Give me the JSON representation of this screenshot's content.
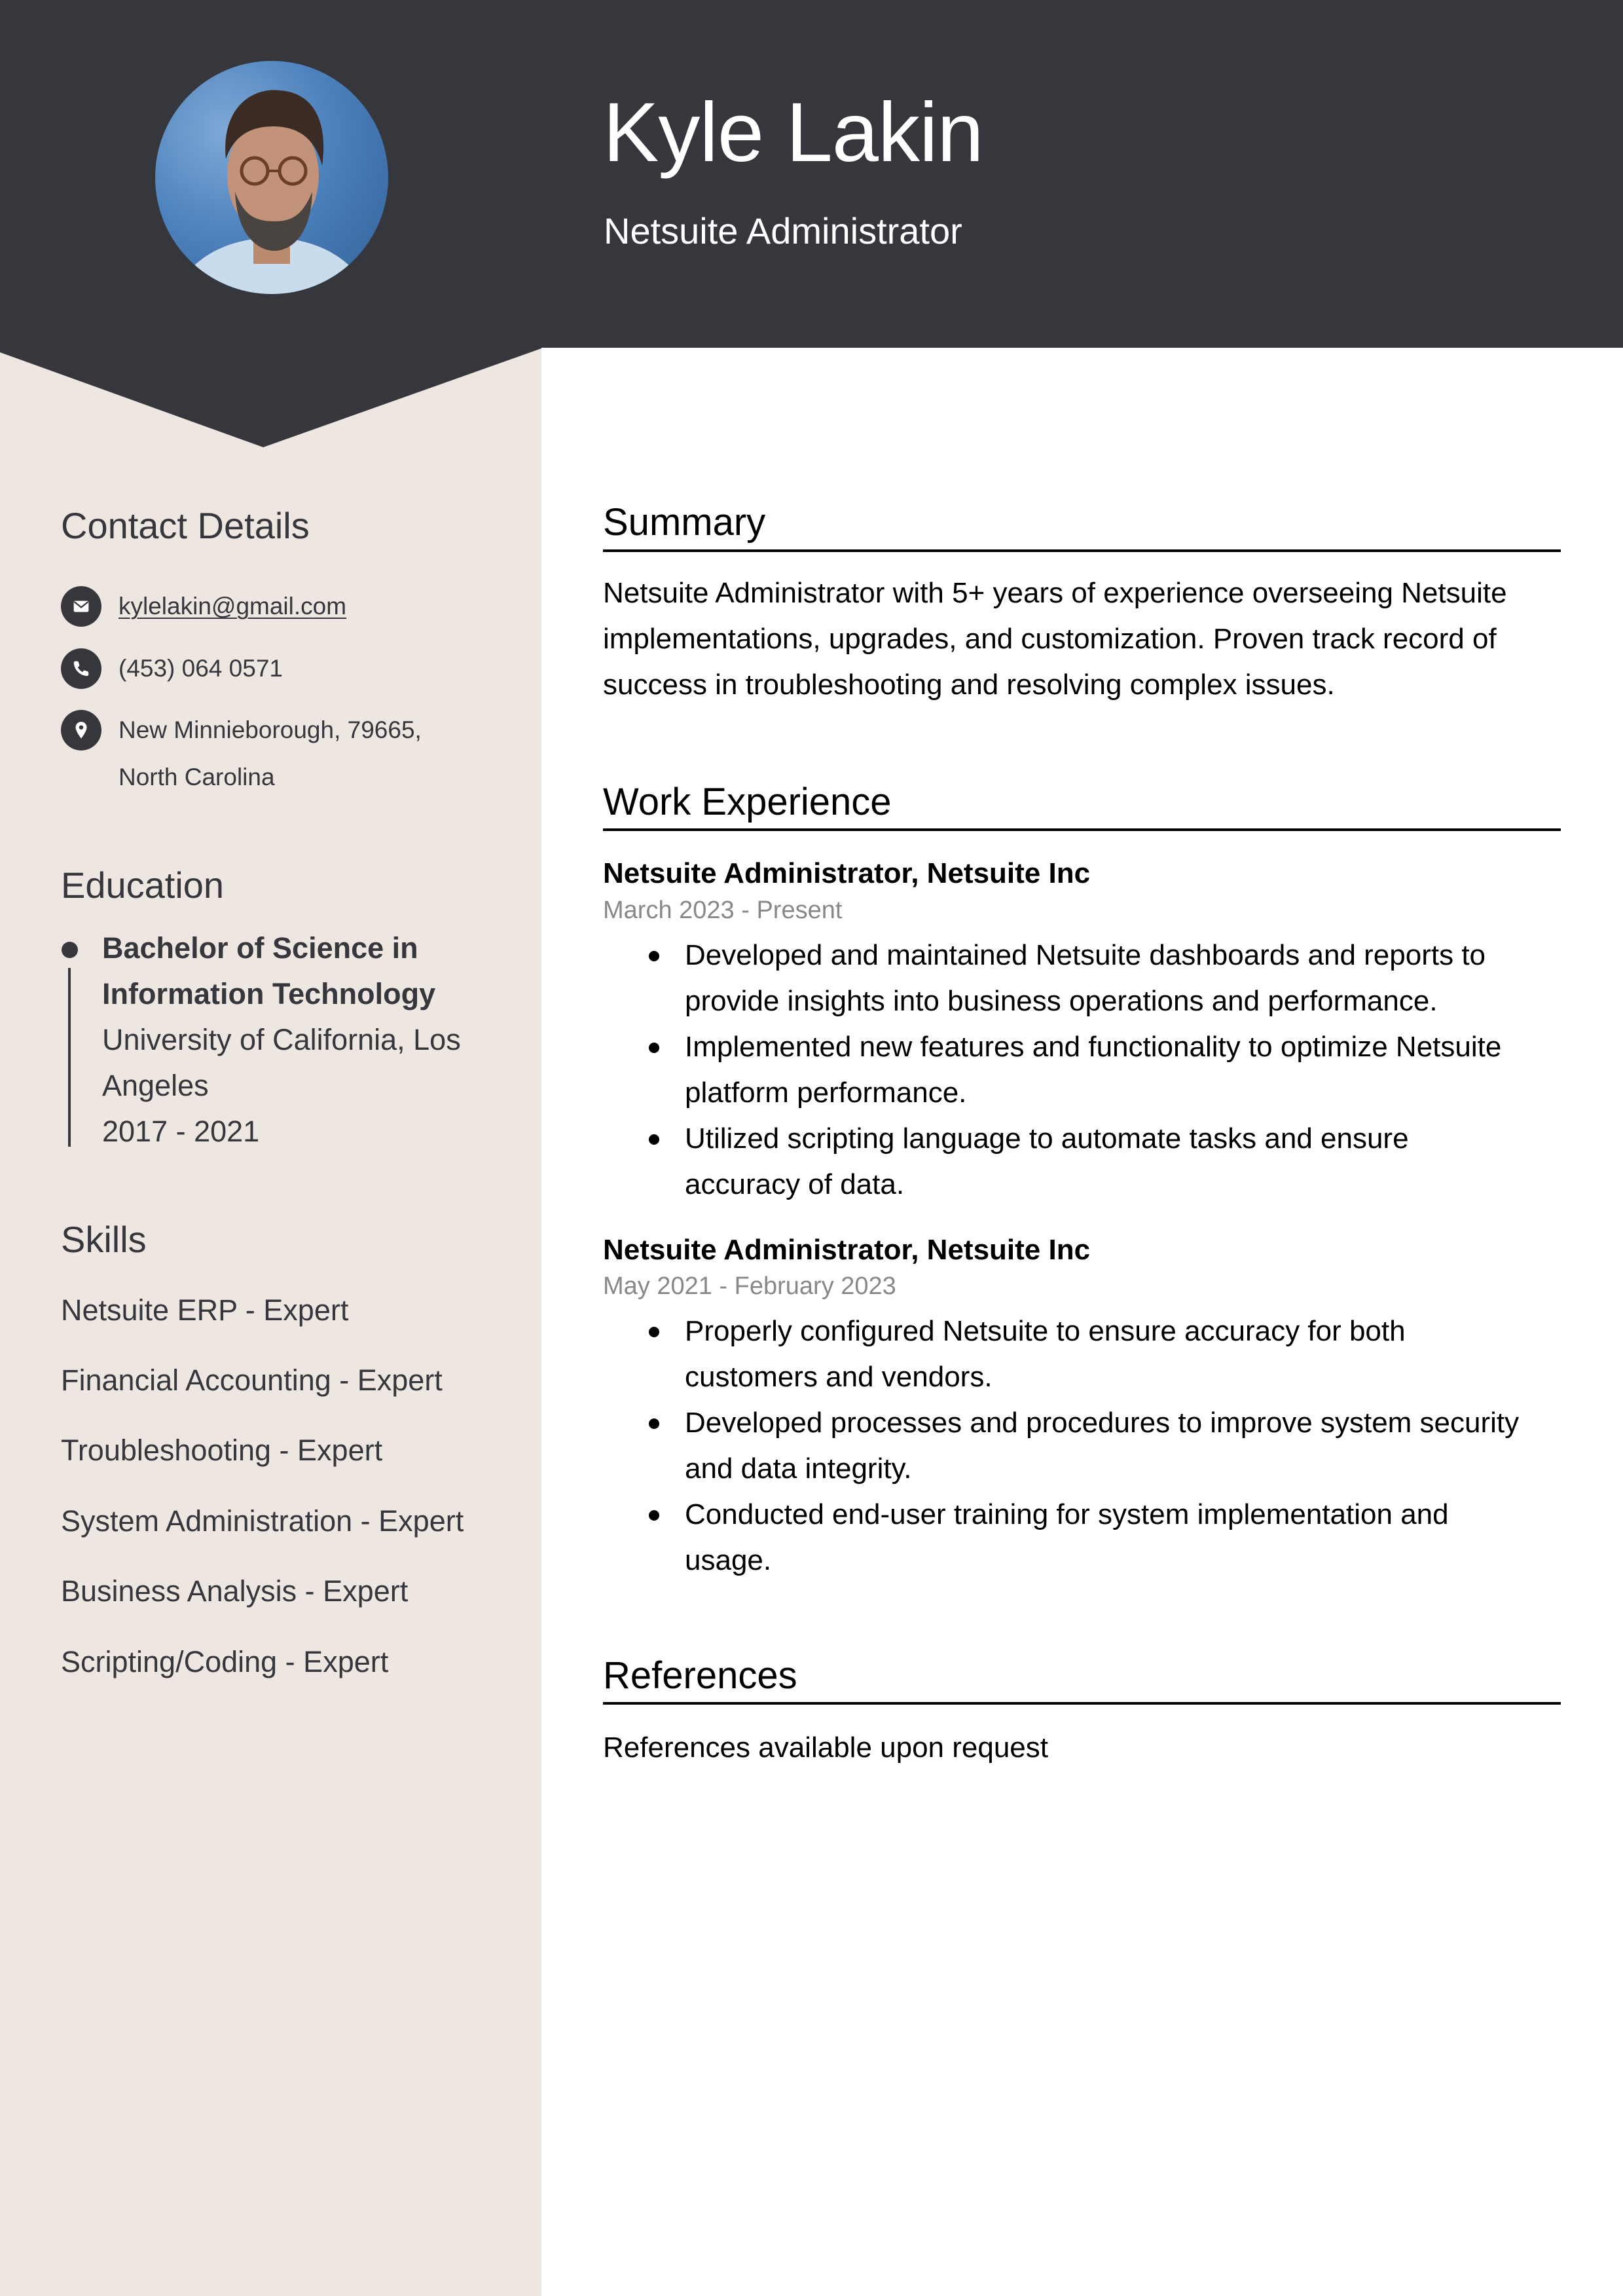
{
  "colors": {
    "header_bg": "#36373D",
    "sidebar_bg": "#EDE6E1",
    "accent_dark": "#36373D",
    "date_gray": "#888888"
  },
  "header": {
    "name": "Kyle Lakin",
    "role": "Netsuite Administrator",
    "photo_alt": "Portrait photo"
  },
  "sidebar": {
    "contact": {
      "heading": "Contact Details",
      "items": [
        {
          "icon": "envelope-icon",
          "text": "kylelakin@gmail.com",
          "is_link": true
        },
        {
          "icon": "phone-icon",
          "text": "(453) 064 0571"
        },
        {
          "icon": "map-pin-icon",
          "line1": "New Minnieborough, 79665,",
          "line2": "North Carolina"
        }
      ]
    },
    "education": {
      "heading": "Education",
      "items": [
        {
          "degree_line1": "Bachelor of Science in",
          "degree_line2": "Information Technology",
          "school_line1": "University of California, Los",
          "school_line2": "Angeles",
          "years": "2017 - 2021"
        }
      ]
    },
    "skills": {
      "heading": "Skills",
      "items": [
        "Netsuite ERP - Expert",
        "Financial Accounting - Expert",
        "Troubleshooting - Expert",
        "System Administration - Expert",
        "Business Analysis - Expert",
        "Scripting/Coding - Expert"
      ]
    }
  },
  "main": {
    "summary": {
      "heading": "Summary",
      "lines": [
        "Netsuite Administrator with 5+ years of experience overseeing Netsuite",
        "implementations, upgrades, and customization. Proven track record of",
        "success in troubleshooting and resolving complex issues."
      ]
    },
    "experience": {
      "heading": "Work Experience",
      "jobs": [
        {
          "title": "Netsuite Administrator, Netsuite Inc",
          "dates": "March 2023 - Present",
          "bullets": [
            [
              "Developed and maintained Netsuite dashboards and reports to",
              "provide insights into business operations and performance."
            ],
            [
              "Implemented new features and functionality to optimize Netsuite",
              "platform performance."
            ],
            [
              "Utilized scripting language to automate tasks and ensure",
              "accuracy of data."
            ]
          ]
        },
        {
          "title": "Netsuite Administrator, Netsuite Inc",
          "dates": "May 2021 - February 2023",
          "bullets": [
            [
              "Properly configured Netsuite to ensure accuracy for both",
              "customers and vendors."
            ],
            [
              "Developed processes and procedures to improve system security",
              "and data integrity."
            ],
            [
              "Conducted end-user training for system implementation and",
              "usage."
            ]
          ]
        }
      ]
    },
    "references": {
      "heading": "References",
      "text": "References available upon request"
    }
  }
}
